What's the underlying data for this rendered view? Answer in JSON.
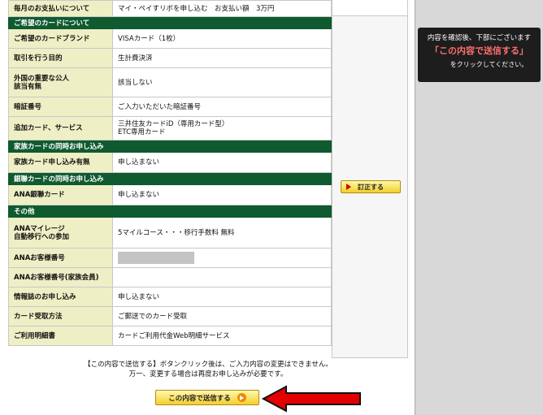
{
  "form": {
    "rows": [
      {
        "type": "row",
        "label": "毎月のお支払いについて",
        "value": "マイ・ペイすリボを申し込む　お支払い額　3万円",
        "height": 20
      },
      {
        "type": "section",
        "title": "ご希望のカードについて"
      },
      {
        "type": "row",
        "label": "ご希望のカードブランド",
        "value": "VISAカード（1枚）",
        "height": 24
      },
      {
        "type": "row",
        "label": "取引を行う目的",
        "value": "生計費決済",
        "height": 24
      },
      {
        "type": "row",
        "label": "外国の重要な公人\n該当有無",
        "value": "該当しない",
        "height": 36
      },
      {
        "type": "row",
        "label": "暗証番号",
        "value": "ご入力いただいた暗証番号",
        "height": 24
      },
      {
        "type": "row",
        "label": "追加カード、サービス",
        "value": "三井住友カードiD（専用カード型）\nETC専用カード",
        "height": 29
      },
      {
        "type": "section",
        "title": "家族カードの同時お申し込み"
      },
      {
        "type": "row",
        "label": "家族カード申し込み有無",
        "value": "申し込まない",
        "height": 25
      },
      {
        "type": "section",
        "title": "銀聯カードの同時お申し込み"
      },
      {
        "type": "row",
        "label": "ANA銀聯カード",
        "value": "申し込まない",
        "height": 25
      },
      {
        "type": "section",
        "title": "その他"
      },
      {
        "type": "row",
        "label": "ANAマイレージ\n自動移行への参加",
        "value": "5マイルコース・・・移行手数料 無料",
        "height": 38
      },
      {
        "type": "row",
        "label": "ANAお客様番号",
        "value": "",
        "masked": true,
        "height": 24
      },
      {
        "type": "row",
        "label": "ANAお客様番号(家族会員)",
        "value": "",
        "height": 24
      },
      {
        "type": "row",
        "label": "情報誌のお申し込み",
        "value": "申し込まない",
        "height": 24
      },
      {
        "type": "row",
        "label": "カード受取方法",
        "value": "ご郵送でのカード受取",
        "height": 24
      },
      {
        "type": "row",
        "label": "ご利用明細書",
        "value": "カードご利用代金Web明細サービス",
        "height": 24
      }
    ]
  },
  "correct_button": {
    "label": "訂正する"
  },
  "note": {
    "line1": "【この内容で送信する】ボタンクリック後は、ご入力内容の変更はできません。",
    "line2": "万一、変更する場合は再度お申し込みが必要です。"
  },
  "submit_button": {
    "label": "この内容で送信する"
  },
  "side_panel": {
    "line1": "内容を確認後、下部にございます",
    "highlight": "「この内容で送信する」",
    "line3": "をクリックしてください。"
  },
  "colors": {
    "section_bg": "#0f5a2f",
    "label_bg": "#efefc6",
    "highlight": "#ff6f6f",
    "arrow": "#e40000"
  }
}
